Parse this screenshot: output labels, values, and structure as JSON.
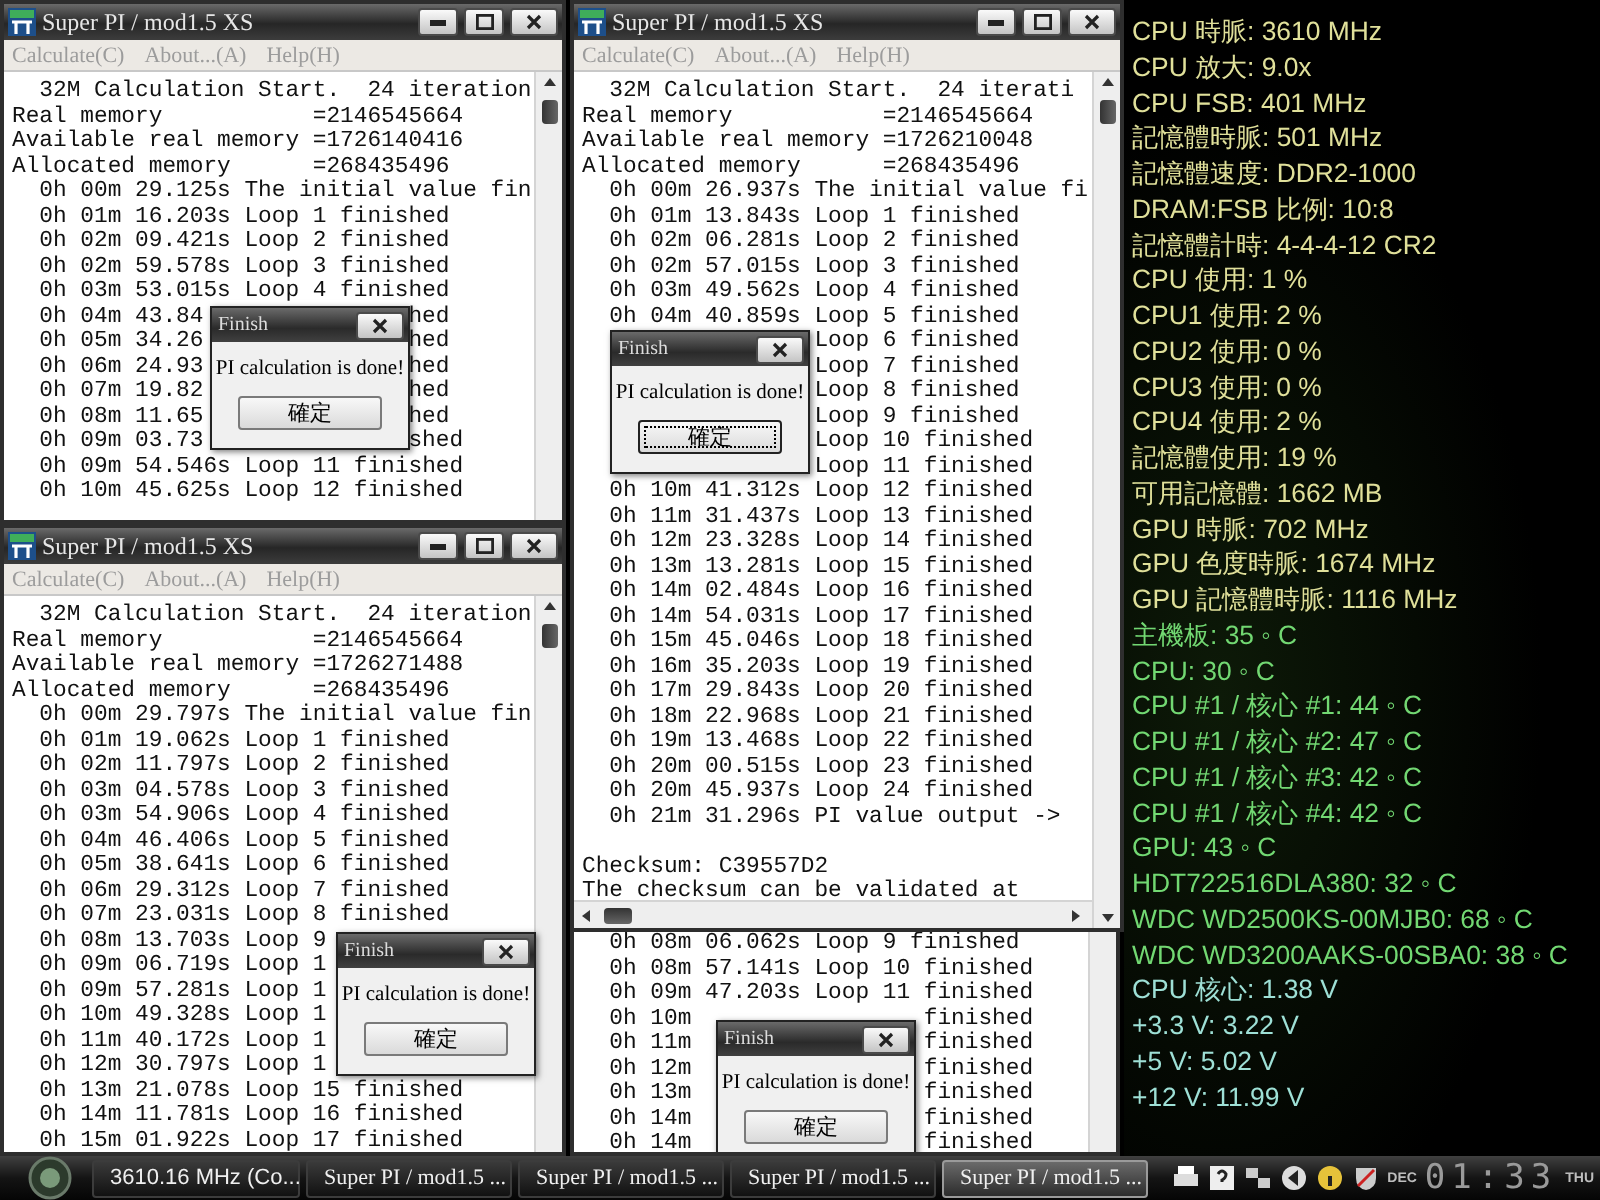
{
  "windows": [
    {
      "kind": "plain",
      "title": "Super PI / mod1.5 XS",
      "menu": [
        {
          "label": "Calculate(C)",
          "disabled": true
        },
        {
          "label": "About...(A)",
          "disabled": true
        },
        {
          "label": "Help(H)",
          "disabled": true
        }
      ],
      "lines": [
        "  32M Calculation Start.  24 iteration",
        "Real memory           =2146545664",
        "Available real memory =1726140416",
        "Allocated memory      =268435496",
        "  0h 00m 29.125s The initial value fin",
        "  0h 01m 16.203s Loop 1 finished",
        "  0h 02m 09.421s Loop 2 finished",
        "  0h 02m 59.578s Loop 3 finished",
        "  0h 03m 53.015s Loop 4 finished",
        {
          "text": "  0h 04m 43.84",
          "tail": "hed"
        },
        {
          "text": "  0h 05m 34.26",
          "tail": "hed"
        },
        {
          "text": "  0h 06m 24.93",
          "tail": "hed"
        },
        {
          "text": "  0h 07m 19.82",
          "tail": "hed"
        },
        {
          "text": "  0h 08m 11.65",
          "tail": "hed"
        },
        {
          "text": "  0h 09m 03.73",
          "tail": "shed"
        },
        "  0h 09m 54.546s Loop 11 finished",
        "  0h 10m 45.625s Loop 12 finished"
      ],
      "dialog": {
        "title": "Finish",
        "message": "PI calculation is done!",
        "button": "確定",
        "focused": false
      }
    },
    {
      "kind": "scrolled",
      "title": "Super PI / mod1.5 XS",
      "menu": [
        {
          "label": "Calculate(C)",
          "disabled": true
        },
        {
          "label": "About...(A)",
          "disabled": true
        },
        {
          "label": "Help(H)",
          "disabled": true
        }
      ],
      "lines": [
        "  32M Calculation Start.  24 iterati",
        "Real memory           =2146545664",
        "Available real memory =1726210048",
        "Allocated memory      =268435496",
        "  0h 00m 26.937s The initial value fi",
        "  0h 01m 13.843s Loop 1 finished",
        "  0h 02m 06.281s Loop 2 finished",
        "  0h 02m 57.015s Loop 3 finished",
        "  0h 03m 49.562s Loop 4 finished",
        "  0h 04m 40.859s Loop 5 finished",
        {
          "tail": "Loop 6 finished"
        },
        {
          "tail": "Loop 7 finished"
        },
        {
          "tail": "Loop 8 finished"
        },
        {
          "tail": "Loop 9 finished"
        },
        {
          "tail": "Loop 10 finished"
        },
        {
          "tail": "Loop 11 finished"
        },
        "  0h 10m 41.312s Loop 12 finished",
        "  0h 11m 31.437s Loop 13 finished",
        "  0h 12m 23.328s Loop 14 finished",
        "  0h 13m 13.281s Loop 15 finished",
        "  0h 14m 02.484s Loop 16 finished",
        "  0h 14m 54.031s Loop 17 finished",
        "  0h 15m 45.046s Loop 18 finished",
        "  0h 16m 35.203s Loop 19 finished",
        "  0h 17m 29.843s Loop 20 finished",
        "  0h 18m 22.968s Loop 21 finished",
        "  0h 19m 13.468s Loop 22 finished",
        "  0h 20m 00.515s Loop 23 finished",
        "  0h 20m 45.937s Loop 24 finished",
        "  0h 21m 31.296s PI value output ->",
        {
          "kind": "gap"
        },
        "Checksum: C39557D2",
        "The checksum can be validated at"
      ],
      "dialog": {
        "title": "Finish",
        "message": "PI calculation is done!",
        "button": "確定",
        "focused": true
      }
    },
    {
      "kind": "plain",
      "title": "Super PI / mod1.5 XS",
      "menu": [
        {
          "label": "Calculate(C)",
          "disabled": true
        },
        {
          "label": "About...(A)",
          "disabled": true
        },
        {
          "label": "Help(H)",
          "disabled": true
        }
      ],
      "lines": [
        "  32M Calculation Start.  24 iteration",
        "Real memory           =2146545664",
        "Available real memory =1726271488",
        "Allocated memory      =268435496",
        "  0h 00m 29.797s The initial value fin",
        "  0h 01m 19.062s Loop 1 finished",
        "  0h 02m 11.797s Loop 2 finished",
        "  0h 03m 04.578s Loop 3 finished",
        "  0h 03m 54.906s Loop 4 finished",
        "  0h 04m 46.406s Loop 5 finished",
        "  0h 05m 38.641s Loop 6 finished",
        "  0h 06m 29.312s Loop 7 finished",
        "  0h 07m 23.031s Loop 8 finished",
        "  0h 08m 13.703s Loop 9",
        "  0h 09m 06.719s Loop 1",
        "  0h 09m 57.281s Loop 1",
        "  0h 10m 49.328s Loop 1",
        "  0h 11m 40.172s Loop 1",
        "  0h 12m 30.797s Loop 1",
        "  0h 13m 21.078s Loop 15 finished",
        "  0h 14m 11.781s Loop 16 finished",
        "  0h 15m 01.922s Loop 17 finished"
      ],
      "dialog": {
        "title": "Finish",
        "message": "PI calculation is done!",
        "button": "確定",
        "focused": false
      }
    },
    {
      "kind": "fragment",
      "lines": [
        "  0h 08m 06.062s Loop 9 finished",
        "  0h 08m 57.141s Loop 10 finished",
        "  0h 09m 47.203s Loop 11 finished",
        {
          "text": "  0h 10m",
          "tail": "finished"
        },
        {
          "text": "  0h 11m",
          "tail": "finished"
        },
        {
          "text": "  0h 12m",
          "tail": "finished"
        },
        {
          "text": "  0h 13m",
          "tail": "finished"
        },
        {
          "text": "  0h 14m",
          "tail": "finished"
        },
        {
          "text": "  0h 14m",
          "tail": "finished"
        }
      ],
      "dialog": {
        "title": "Finish",
        "message": "PI calculation is done!",
        "button": "確定",
        "focused": false
      }
    }
  ],
  "monitor": [
    {
      "text": "CPU 時脈: 3610 MHz",
      "color": "#e0e09a"
    },
    {
      "text": "CPU 放大: 9.0x",
      "color": "#e0e09a"
    },
    {
      "text": "CPU FSB: 401 MHz",
      "color": "#e0e09a"
    },
    {
      "text": "記憶體時脈: 501 MHz",
      "color": "#e0e09a"
    },
    {
      "text": "記憶體速度: DDR2-1000",
      "color": "#e0e09a"
    },
    {
      "text": "DRAM:FSB 比例: 10:8",
      "color": "#e0e09a"
    },
    {
      "text": "記憶體計時: 4-4-4-12 CR2",
      "color": "#e0e09a"
    },
    {
      "text": "CPU 使用: 1 %",
      "color": "#e0e09a"
    },
    {
      "text": "CPU1 使用: 2 %",
      "color": "#e0e09a"
    },
    {
      "text": "CPU2 使用: 0 %",
      "color": "#e0e09a"
    },
    {
      "text": "CPU3 使用: 0 %",
      "color": "#e0e09a"
    },
    {
      "text": "CPU4 使用: 2 %",
      "color": "#e0e09a"
    },
    {
      "text": "記憶體使用: 19 %",
      "color": "#e0e09a"
    },
    {
      "text": "可用記憶體: 1662 MB",
      "color": "#e0e09a"
    },
    {
      "text": "GPU 時脈: 702 MHz",
      "color": "#e0e09a"
    },
    {
      "text": "GPU 色度時脈: 1674 MHz",
      "color": "#e0e09a"
    },
    {
      "text": "GPU 記憶體時脈: 1116 MHz",
      "color": "#e0e09a"
    },
    {
      "text": "主機板: 35 ◦ C",
      "color": "#72d872"
    },
    {
      "text": "CPU: 30 ◦ C",
      "color": "#72d872"
    },
    {
      "text": "CPU #1 / 核心 #1: 44 ◦ C",
      "color": "#72d872"
    },
    {
      "text": "CPU #1 / 核心 #2: 47 ◦ C",
      "color": "#72d872"
    },
    {
      "text": "CPU #1 / 核心 #3: 42 ◦ C",
      "color": "#72d872"
    },
    {
      "text": "CPU #1 / 核心 #4: 42 ◦ C",
      "color": "#72d872"
    },
    {
      "text": "GPU: 43 ◦ C",
      "color": "#72d872"
    },
    {
      "text": "HDT722516DLA380: 32 ◦ C",
      "color": "#72d872"
    },
    {
      "text": "WDC WD2500KS-00MJB0: 68 ◦ C",
      "color": "#72d872"
    },
    {
      "text": "WDC WD3200AAKS-00SBA0: 38 ◦ C",
      "color": "#72d872"
    },
    {
      "text": "CPU 核心: 1.38 V",
      "color": "#9ee0d6"
    },
    {
      "text": "+3.3 V: 3.22 V",
      "color": "#9ee0d6"
    },
    {
      "text": "+5 V: 5.02 V",
      "color": "#9ee0d6"
    },
    {
      "text": "+12 V: 11.99 V",
      "color": "#9ee0d6"
    }
  ],
  "taskbar": {
    "items": [
      {
        "kind": "monitor",
        "label": "3610.16 MHz (Co...",
        "selected": false
      },
      {
        "kind": "app",
        "label": "Super PI / mod1.5 ...",
        "selected": false
      },
      {
        "kind": "app",
        "label": "Super PI / mod1.5 ...",
        "selected": false
      },
      {
        "kind": "app",
        "label": "Super PI / mod1.5 ...",
        "selected": false
      },
      {
        "kind": "app",
        "label": "Super PI / mod1.5 ...",
        "selected": true
      }
    ],
    "month": "DEC",
    "time": "01:33",
    "weekday": "THU"
  }
}
